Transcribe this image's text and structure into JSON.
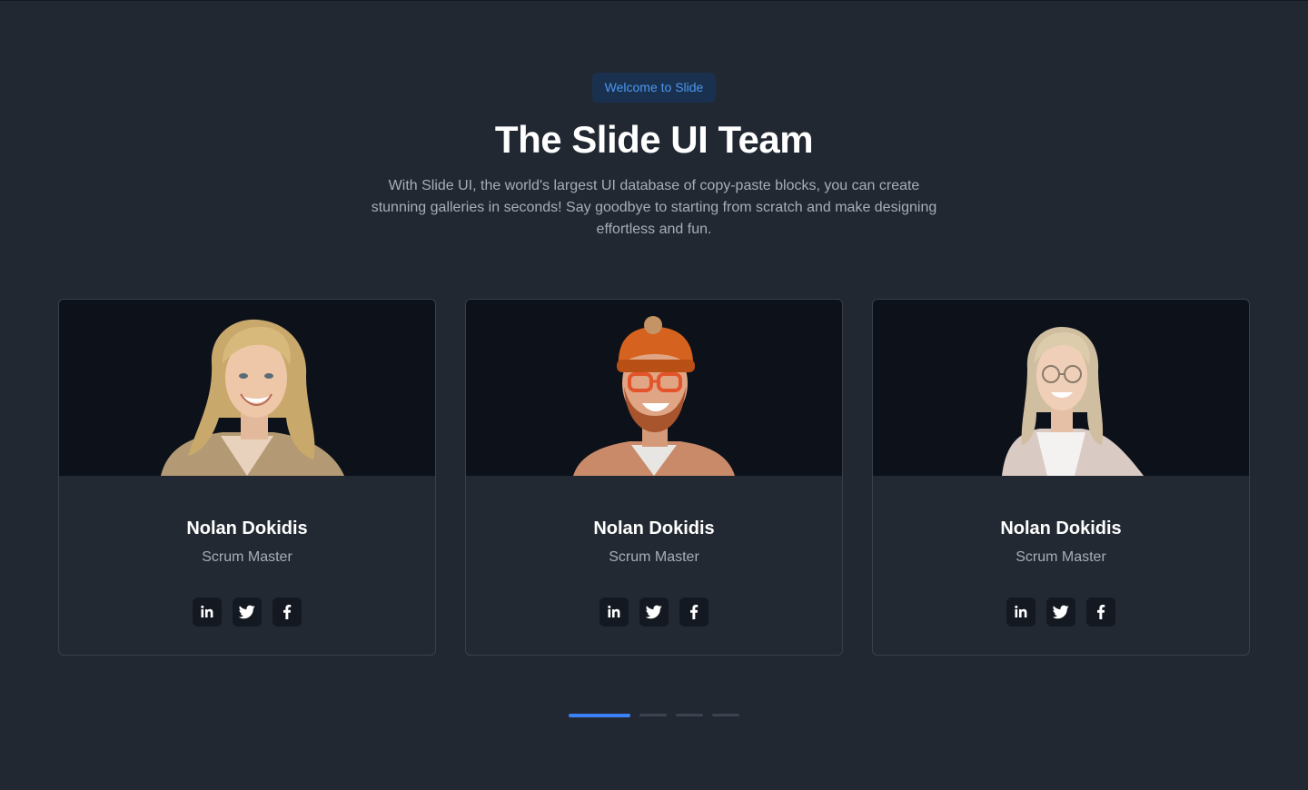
{
  "header": {
    "badge": "Welcome to Slide",
    "title": "The Slide UI Team",
    "description": "With Slide UI, the world's largest UI database of copy-paste blocks, you can create stunning galleries in seconds! Say goodbye to starting from scratch and make designing effortless and fun."
  },
  "colors": {
    "background": "#222831",
    "accent": "#3b82f6",
    "badge_bg": "#19314e",
    "badge_text": "#4c96ef",
    "photo_bg": "#0d1119"
  },
  "team": [
    {
      "name": "Nolan Dokidis",
      "role": "Scrum Master",
      "photo": "woman-blonde-portrait",
      "socials": [
        {
          "label": "in",
          "icon": "linkedin-icon"
        },
        {
          "label": "twitter",
          "icon": "twitter-icon"
        },
        {
          "label": "facebook",
          "icon": "facebook-icon"
        }
      ]
    },
    {
      "name": "Nolan Dokidis",
      "role": "Scrum Master",
      "photo": "man-beanie-glasses-portrait",
      "socials": [
        {
          "label": "in",
          "icon": "linkedin-icon"
        },
        {
          "label": "twitter",
          "icon": "twitter-icon"
        },
        {
          "label": "facebook",
          "icon": "facebook-icon"
        }
      ]
    },
    {
      "name": "Nolan Dokidis",
      "role": "Scrum Master",
      "photo": "woman-glasses-portrait",
      "socials": [
        {
          "label": "in",
          "icon": "linkedin-icon"
        },
        {
          "label": "twitter",
          "icon": "twitter-icon"
        },
        {
          "label": "facebook",
          "icon": "facebook-icon"
        }
      ]
    }
  ],
  "pagination": {
    "pages": 4,
    "active_index": 0
  }
}
